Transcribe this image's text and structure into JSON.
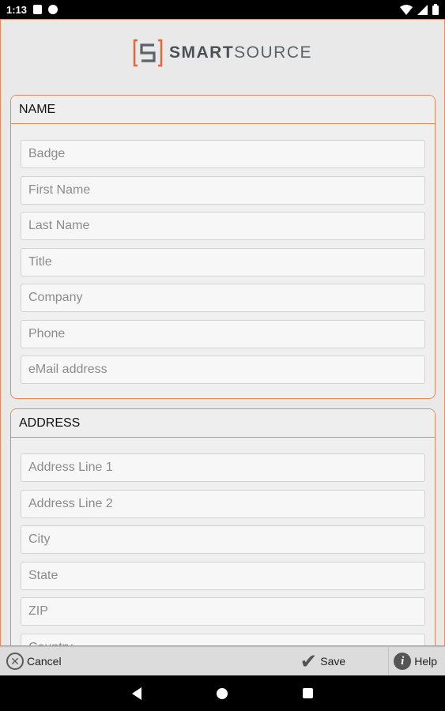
{
  "status_bar": {
    "time": "1:13"
  },
  "logo": {
    "brand_bold": "SMART",
    "brand_light": "SOURCE"
  },
  "name_section": {
    "title": "NAME",
    "fields": [
      {
        "placeholder": "Badge",
        "value": ""
      },
      {
        "placeholder": "First Name",
        "value": ""
      },
      {
        "placeholder": "Last Name",
        "value": ""
      },
      {
        "placeholder": "Title",
        "value": ""
      },
      {
        "placeholder": "Company",
        "value": ""
      },
      {
        "placeholder": "Phone",
        "value": ""
      },
      {
        "placeholder": "eMail address",
        "value": ""
      }
    ]
  },
  "address_section": {
    "title": "ADDRESS",
    "fields": [
      {
        "placeholder": "Address Line 1",
        "value": ""
      },
      {
        "placeholder": "Address Line 2",
        "value": ""
      },
      {
        "placeholder": "City",
        "value": ""
      },
      {
        "placeholder": "State",
        "value": ""
      },
      {
        "placeholder": "ZIP",
        "value": ""
      },
      {
        "placeholder": "Country",
        "value": ""
      }
    ]
  },
  "bottom_bar": {
    "cancel_label": "Cancel",
    "save_label": "Save",
    "help_label": "Help"
  },
  "colors": {
    "accent": "#e7875a",
    "background": "#e9e9e9",
    "logo_gray": "#5d6268"
  },
  "icons": [
    "wifi-icon",
    "signal-icon",
    "battery-icon",
    "close-circle-icon",
    "checkmark-icon",
    "info-icon",
    "nav-back-icon",
    "nav-home-icon",
    "nav-recents-icon"
  ]
}
